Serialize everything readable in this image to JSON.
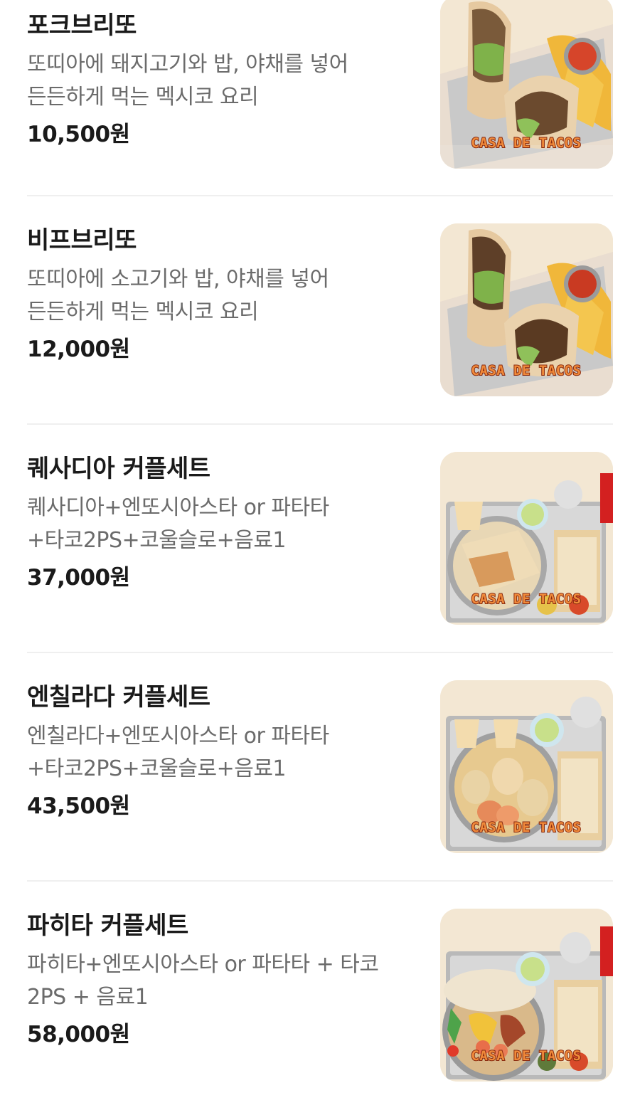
{
  "menu": {
    "items": [
      {
        "name": "포크브리또",
        "description": "또띠아에 돼지고기와 밥, 야채를 넣어 든든하게 먹는 멕시코 요리",
        "price": "10,500원",
        "image_brand": "CASA DE TACOS"
      },
      {
        "name": "비프브리또",
        "description": "또띠아에 소고기와 밥, 야채를 넣어 든든하게 먹는 멕시코 요리",
        "price": "12,000원",
        "image_brand": "CASA DE TACOS"
      },
      {
        "name": "퀘사디아 커플세트",
        "description": "퀘사디아+엔또시아스타 or 파타타+타코2PS+코울슬로+음료1",
        "price": "37,000원",
        "image_brand": "CASA DE TACOS"
      },
      {
        "name": "엔칠라다 커플세트",
        "description": "엔칠라다+엔또시아스타 or 파타타+타코2PS+코울슬로+음료1",
        "price": "43,500원",
        "image_brand": "CASA DE TACOS"
      },
      {
        "name": "파히타 커플세트",
        "description": "파히타+엔또시아스타 or 파타타 + 타코 2PS + 음료1",
        "price": "58,000원",
        "image_brand": "CASA DE TACOS"
      }
    ]
  },
  "colors": {
    "title": "#1a1a1a",
    "description": "#6b6b6b",
    "divider": "#efefef",
    "image_bg": "#f3e7d3",
    "brand_orange": "#f08a3a"
  }
}
